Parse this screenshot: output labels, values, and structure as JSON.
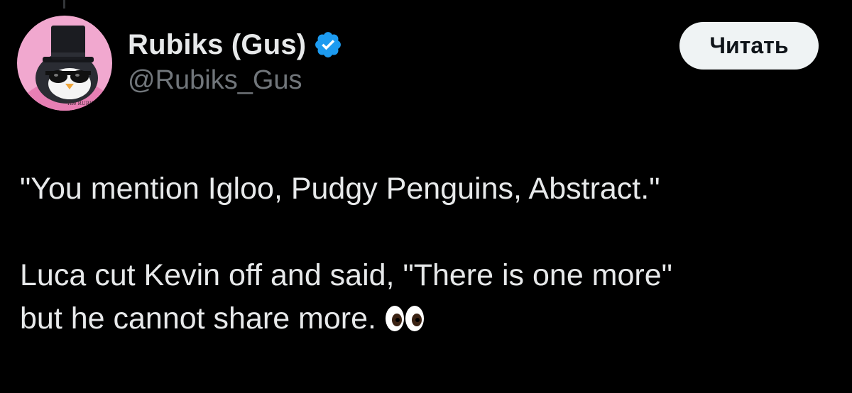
{
  "author": {
    "display_name": "Rubiks (Gus)",
    "handle": "@Rubiks_Gus",
    "verified": true,
    "avatar_icon": "penguin-top-hat-avatar",
    "avatar_shirt_text": "The RUBIKS"
  },
  "actions": {
    "follow_label": "Читать"
  },
  "tweet": {
    "paragraph_1": "\"You mention Igloo, Pudgy Penguins, Abstract.\"",
    "paragraph_2_line_1": "Luca cut Kevin off and said, \"There is one more\"",
    "paragraph_2_line_2": "but he cannot share more.",
    "emoji": "eyes-emoji"
  },
  "colors": {
    "background": "#000000",
    "text_primary": "#e7e9ea",
    "text_secondary": "#71767b",
    "verified_blue": "#1d9bf0",
    "button_bg": "#eff3f4",
    "avatar_bg": "#f1a8cf"
  }
}
